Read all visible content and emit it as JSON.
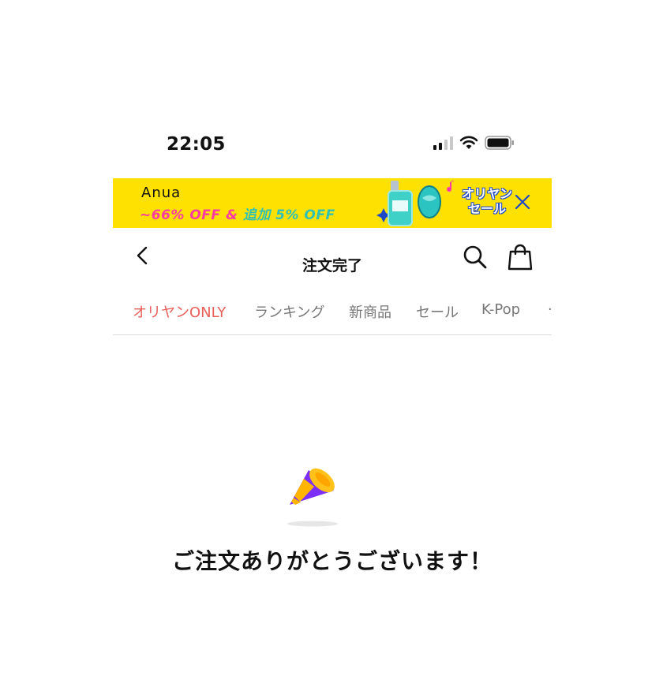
{
  "status_bar": {
    "time": "22:05",
    "icons": [
      "cellular-signal-icon",
      "wifi-icon",
      "battery-icon"
    ]
  },
  "banner": {
    "brand": "Anua",
    "promo_part1": "~66% OFF &",
    "promo_part2": "追加 5% OFF",
    "badge_line1": "オリヤン",
    "badge_line2": "セール",
    "colors": {
      "background": "#ffe100",
      "pink": "#ff3aa5",
      "teal": "#2fc1b6"
    }
  },
  "header": {
    "title": "注文完了",
    "icons": [
      "back-chevron-icon",
      "search-icon",
      "shopping-bag-icon"
    ]
  },
  "tabs": [
    {
      "label": "オリヤンONLY",
      "active": true
    },
    {
      "label": "ランキング",
      "active": false
    },
    {
      "label": "新商品",
      "active": false
    },
    {
      "label": "セール",
      "active": false
    },
    {
      "label": "K-Pop",
      "active": false
    }
  ],
  "content": {
    "icon": "party-popper-icon",
    "message": "ご注文ありがとうございます！"
  },
  "colors": {
    "accent": "#e8605a",
    "tab_inactive": "#777777"
  }
}
